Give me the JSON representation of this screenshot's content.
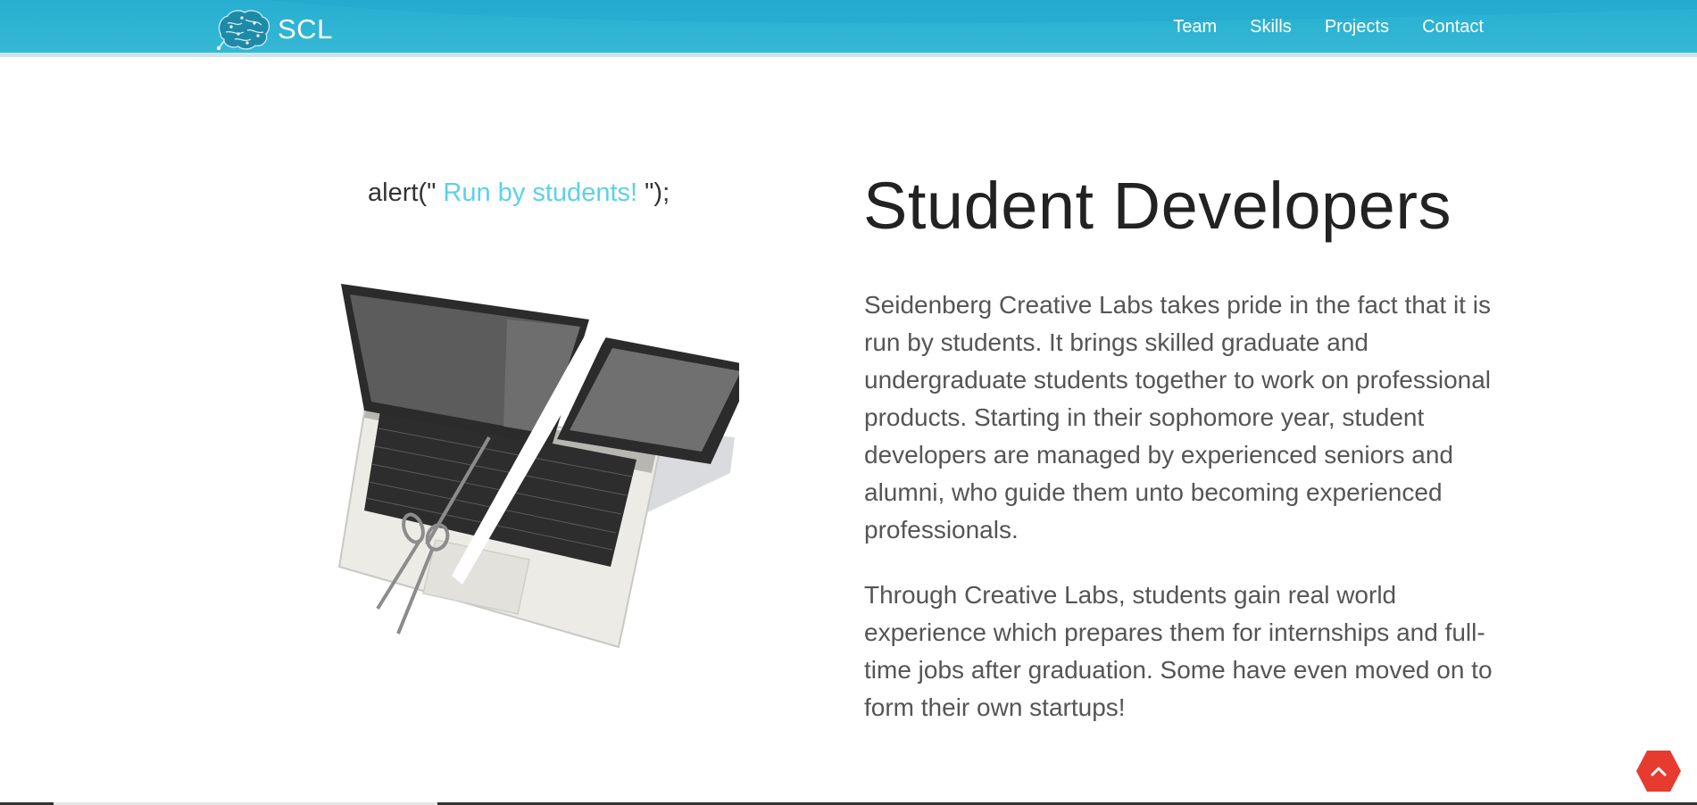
{
  "header": {
    "brand": "SCL",
    "nav": [
      "Team",
      "Skills",
      "Projects",
      "Contact"
    ]
  },
  "hero": {
    "alert_prefix": "alert(\"",
    "alert_highlight": " Run by students! ",
    "alert_suffix": "\");",
    "title": "Student Developers",
    "paragraphs": [
      "Seidenberg Creative Labs takes pride in the fact that it is run by students. It brings skilled graduate and undergraduate students together to work on professional products. Starting in their sophomore year, student developers are managed by experienced seniors and alumni, who guide them unto becoming experienced professionals.",
      "Through Creative Labs, students gain real world experience which prepares them for internships and full-time jobs after graduation. Some have even moved on to form their own startups!"
    ]
  },
  "colors": {
    "header": "#27aed0",
    "accent": "#5cd1e8",
    "back_to_top": "#e63b2e"
  },
  "icons": {
    "logo": "brain-icon",
    "illustration": "laptop-scissors-illustration",
    "back_to_top": "chevron-up-icon"
  }
}
